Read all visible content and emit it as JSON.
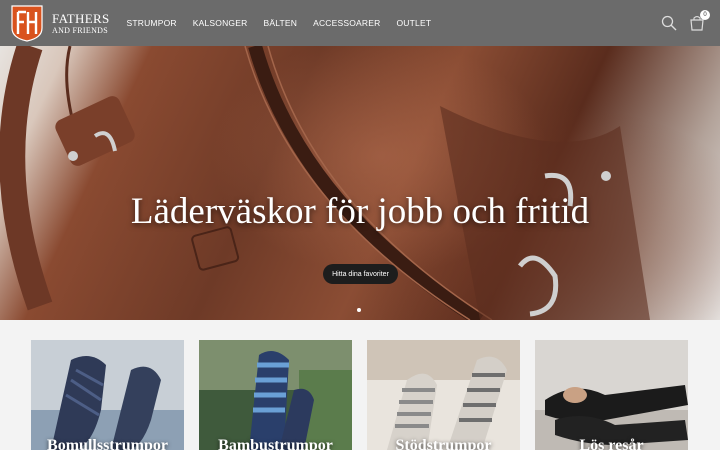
{
  "header": {
    "brand_line1": "FATHERS",
    "brand_line2": "AND FRIENDS",
    "nav": [
      "STRUMPOR",
      "KALSONGER",
      "BÄLTEN",
      "ACCESSOARER",
      "OUTLET"
    ],
    "cart_count": "0",
    "icons": [
      "search-icon",
      "cart-icon"
    ],
    "colors": {
      "bar": "#6b6b6b",
      "logo_orange": "#d9531e"
    }
  },
  "hero": {
    "title": "Läderväskor för jobb och fritid",
    "button_label": "Hitta dina favoriter",
    "slide_indicator_count": 1
  },
  "categories": [
    {
      "label": "Bomullsstrumpor"
    },
    {
      "label": "Bambustrumpor"
    },
    {
      "label": "Stödstrumpor"
    },
    {
      "label": "Lös resår"
    }
  ]
}
